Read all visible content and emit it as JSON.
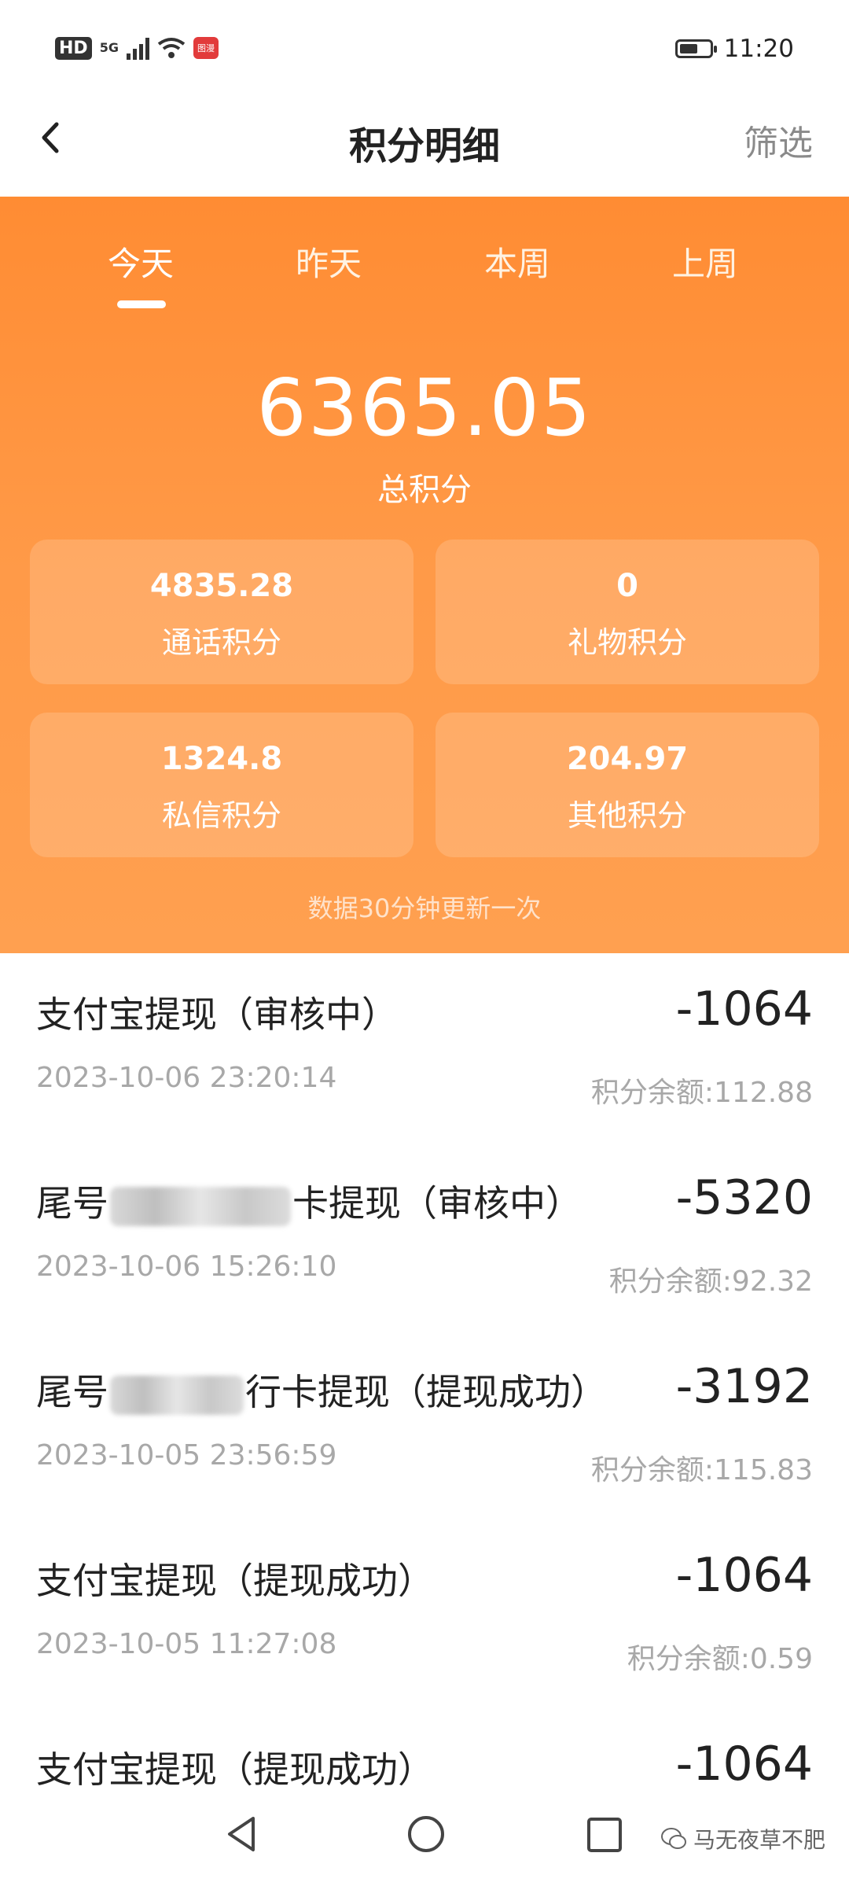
{
  "status_bar": {
    "network": "5G",
    "hd": "HD",
    "app_badge": "图漫",
    "time": "11:20",
    "battery_level": 0.6
  },
  "header": {
    "title": "积分明细",
    "filter": "筛选"
  },
  "tabs": [
    {
      "label": "今天",
      "active": true
    },
    {
      "label": "昨天",
      "active": false
    },
    {
      "label": "本周",
      "active": false
    },
    {
      "label": "上周",
      "active": false
    }
  ],
  "summary": {
    "total": "6365.05",
    "total_label": "总积分",
    "cards": [
      {
        "value": "4835.28",
        "label": "通话积分"
      },
      {
        "value": "0",
        "label": "礼物积分"
      },
      {
        "value": "1324.8",
        "label": "私信积分"
      },
      {
        "value": "204.97",
        "label": "其他积分"
      }
    ],
    "note": "数据30分钟更新一次"
  },
  "records": [
    {
      "title": "支付宝提现（审核中）",
      "amount": "-1064",
      "date": "2023-10-06 23:20:14",
      "balance": "积分余额:112.88"
    },
    {
      "title_prefix": "尾号",
      "title_suffix": "卡提现（审核中）",
      "amount": "-5320",
      "date": "2023-10-06 15:26:10",
      "balance": "积分余额:92.32"
    },
    {
      "title_prefix": "尾号",
      "title_suffix": "行卡提现（提现成功）",
      "amount": "-3192",
      "date": "2023-10-05 23:56:59",
      "balance": "积分余额:115.83"
    },
    {
      "title": "支付宝提现（提现成功）",
      "amount": "-1064",
      "date": "2023-10-05 11:27:08",
      "balance": "积分余额:0.59"
    },
    {
      "title": "支付宝提现（提现成功）",
      "amount": "-1064"
    }
  ],
  "watermark": "马无夜草不肥",
  "colors": {
    "accent": "#ff8c33",
    "text": "#222222",
    "muted": "#a8a8a8"
  }
}
